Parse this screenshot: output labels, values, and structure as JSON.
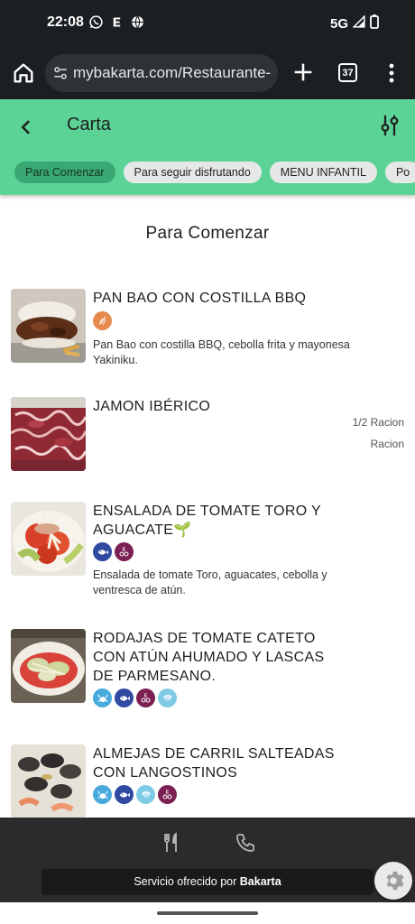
{
  "status_bar": {
    "time": "22:08",
    "network": "5G"
  },
  "browser": {
    "url": "mybakarta.com/Restaurante-",
    "tab_count": "37"
  },
  "header": {
    "title": "Carta"
  },
  "chips": [
    {
      "label": "Para Comenzar",
      "active": true
    },
    {
      "label": "Para seguir disfrutando",
      "active": false
    },
    {
      "label": "MENU INFANTIL",
      "active": false
    },
    {
      "label": "Po",
      "active": false
    }
  ],
  "section": {
    "title": "Para Comenzar"
  },
  "items": [
    {
      "name": "PAN BAO CON COSTILLA BBQ",
      "allergens": [
        "gluten"
      ],
      "description": "Pan Bao con costilla BBQ, cebolla frita y mayonesa Yakiniku.",
      "prices": []
    },
    {
      "name": "JAMON IBÉRICO",
      "allergens": [],
      "description": "",
      "prices": [
        "1/2 Racion",
        "Racion"
      ]
    },
    {
      "name": "ENSALADA DE TOMATE TORO Y AGUACATE🌱",
      "allergens": [
        "fish",
        "sulfites"
      ],
      "description": "Ensalada de tomate Toro, aguacates, cebolla y ventresca de atún.",
      "prices": []
    },
    {
      "name": "RODAJAS DE TOMATE CATETO CON ATÚN AHUMADO Y LASCAS DE PARMESANO.",
      "allergens": [
        "crustaceans",
        "fish",
        "sulfites",
        "molluscs"
      ],
      "description": "",
      "prices": []
    },
    {
      "name": "ALMEJAS DE CARRIL SALTEADAS CON LANGOSTINOS",
      "allergens": [
        "crustaceans",
        "fish",
        "molluscs",
        "sulfites"
      ],
      "description": "",
      "prices": []
    }
  ],
  "bottom": {
    "service_prefix": "Servicio ofrecido por",
    "service_brand": "Bakarta"
  },
  "colors": {
    "header": "#5cd396",
    "chip_active": "#3aa873",
    "bottom": "#2b2b2b",
    "gluten": "#e58a4c",
    "fish": "#2f4aa0",
    "sulfites": "#7c1f53",
    "crustaceans": "#48a9dd",
    "molluscs": "#7fcbe6"
  }
}
